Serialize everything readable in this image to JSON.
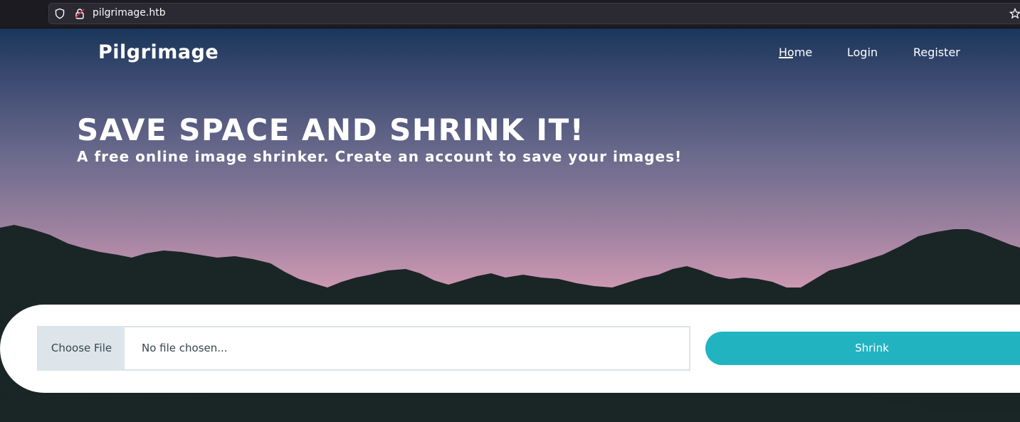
{
  "browser": {
    "url": "pilgrimage.htb"
  },
  "header": {
    "brand": "Pilgrimage",
    "nav": {
      "home": "Home",
      "login": "Login",
      "register": "Register",
      "active": "Home"
    }
  },
  "hero": {
    "title": "SAVE SPACE AND SHRINK IT!",
    "subtitle": "A free online image shrinker. Create an account to save your images!"
  },
  "upload": {
    "choose_label": "Choose File",
    "file_status": "No file chosen...",
    "submit_label": "Shrink"
  },
  "colors": {
    "accent": "#22b3c1",
    "sky_top": "#1b365a",
    "sky_horizon": "#e4a7bf",
    "mountains": "#1a2526"
  },
  "icons": [
    "shield-icon",
    "lock-icon",
    "star-icon"
  ]
}
